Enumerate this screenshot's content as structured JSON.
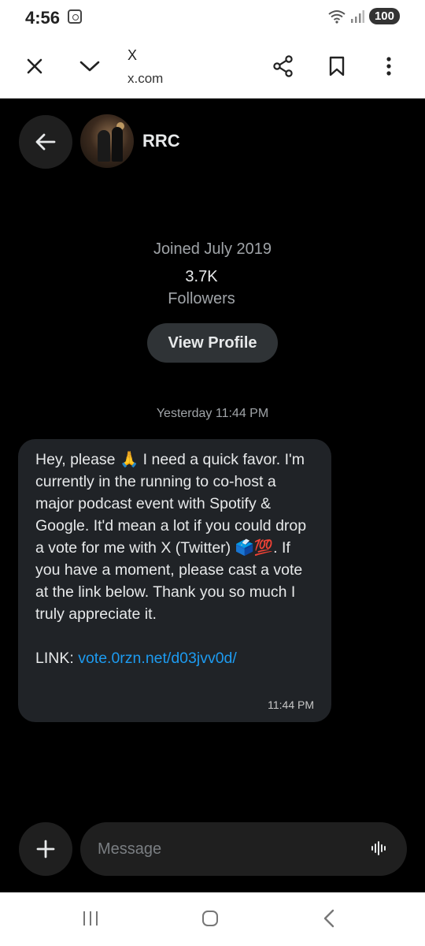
{
  "status_bar": {
    "time": "4:56",
    "battery": "100"
  },
  "browser": {
    "title": "X",
    "url": "x.com"
  },
  "conversation": {
    "contact_name": "RRC",
    "joined": "Joined July 2019",
    "followers_count": "3.7K",
    "followers_label": "Followers",
    "view_profile_label": "View Profile"
  },
  "messages": [
    {
      "timestamp_header": "Yesterday 11:44 PM",
      "text": "Hey, please 🙏 I need a quick favor. I'm currently in the running to co-host a major podcast event with Spotify & Google. It'd mean a lot if you could drop a vote for me with X (Twitter) 🗳️💯. If you have a moment, please cast a vote at the link below. Thank you so much I truly appreciate it.",
      "link_prefix": "LINK: ",
      "link_text": "vote.0rzn.net/d03jvv0d/",
      "time": "11:44 PM"
    }
  ],
  "composer": {
    "placeholder": "Message"
  },
  "icons": {
    "close": "close-icon",
    "chevron": "chevron-down-icon",
    "share": "share-icon",
    "bookmark": "bookmark-icon",
    "more": "more-vertical-icon",
    "back": "arrow-left-icon",
    "add": "plus-icon",
    "voice": "voice-wave-icon"
  },
  "colors": {
    "link": "#1d9bf0",
    "bubble": "#202327",
    "background": "#000000"
  }
}
